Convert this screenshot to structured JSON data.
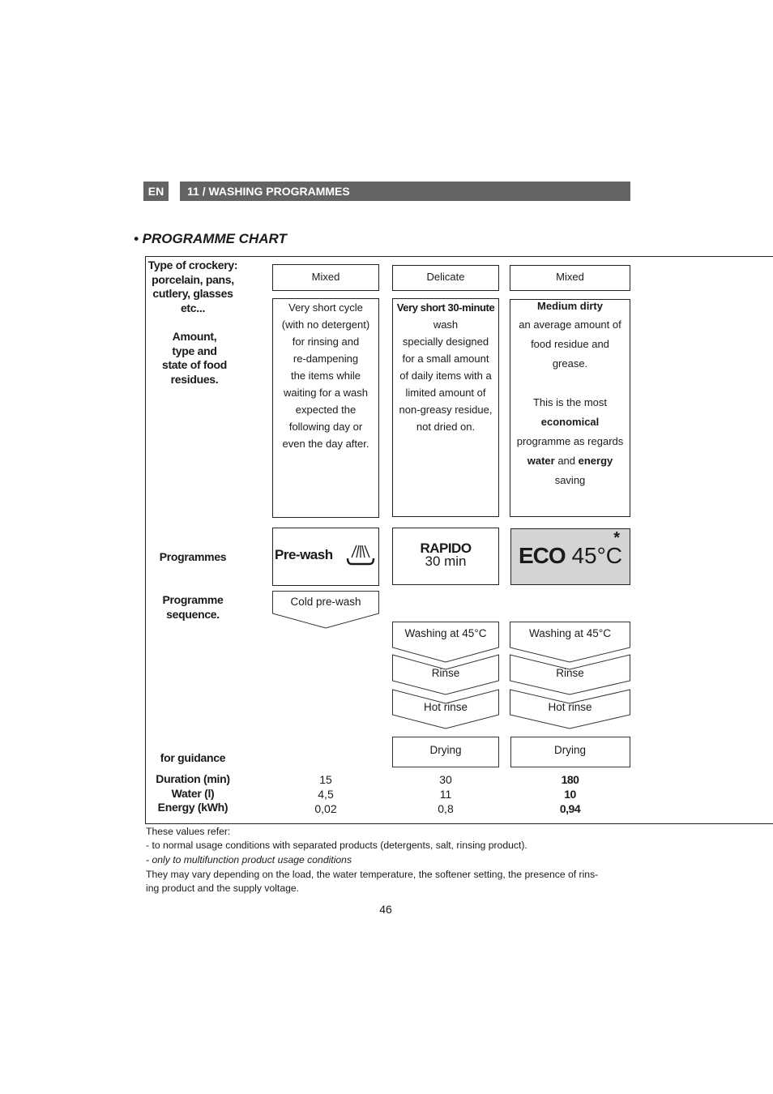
{
  "header": {
    "lang": "EN",
    "section": "11 / WASHING PROGRAMMES"
  },
  "title": "• PROGRAMME CHART",
  "labels": {
    "crockery": [
      "Type of crockery:",
      "porcelain, pans,",
      "cutlery, glasses",
      "etc..."
    ],
    "amount": [
      "Amount,",
      "type and",
      "state of food",
      "residues."
    ],
    "programmes": "Programmes",
    "sequence": [
      "Programme",
      "sequence."
    ],
    "guidance": "for guidance",
    "metrics": [
      "Duration (min)",
      "Water (l)",
      "Energy (kWh)"
    ]
  },
  "columns": [
    {
      "crockery": "Mixed",
      "desc": [
        "Very short cycle",
        "(with no detergent)",
        "for rinsing and",
        "re-dampening",
        "the items while",
        "waiting for a wash",
        "expected the",
        "following day or",
        "even the day after."
      ],
      "programme": "Pre-wash",
      "icon": "shower-icon",
      "steps": [
        "Cold pre-wash"
      ],
      "values": [
        "15",
        "4,5",
        "0,02"
      ]
    },
    {
      "crockery": "Delicate",
      "desc": [
        "Very short 30-minute",
        "wash",
        "specially designed",
        "for a small amount",
        "of daily items with a",
        "limited amount of",
        "non-greasy residue,",
        "not dried on."
      ],
      "programme": "RAPIDO",
      "programme_sub": "30 min",
      "steps": [
        "Washing at 45°C",
        "Rinse",
        "Hot rinse",
        "Drying"
      ],
      "values": [
        "30",
        "11",
        "0,8"
      ]
    },
    {
      "crockery": "Mixed",
      "desc_head": "Medium dirty",
      "desc": [
        "an average amount of",
        "food residue and",
        "grease.",
        "",
        "This is the most"
      ],
      "desc_bold": "economical",
      "desc2": "programme as regards",
      "desc3_a": "water",
      "desc3_b": " and ",
      "desc3_c": "energy",
      "desc4": "saving",
      "programme": "ECO",
      "programme_sub": "45°C",
      "asterisk": "*",
      "steps": [
        "Washing at 45°C",
        "Rinse",
        "Hot rinse",
        "Drying"
      ],
      "values": [
        "180",
        "10",
        "0,94"
      ],
      "highlight": "#d4d4d6"
    }
  ],
  "notes": [
    "These values refer:",
    "- to normal usage conditions with separated products (detergents, salt, rinsing product).",
    "- only to multifunction product usage conditions",
    "They may vary depending on the load, the water temperature, the softener setting, the presence of rins-",
    "ing product and the supply voltage."
  ],
  "page_number": "46"
}
